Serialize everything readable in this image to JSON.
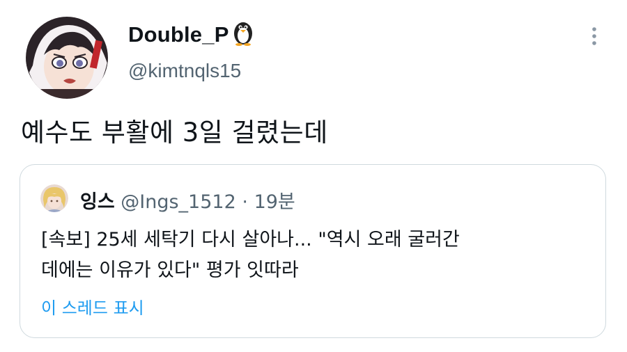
{
  "tweet": {
    "author": {
      "display_name": "Double_P",
      "handle": "@kimtnqls15",
      "avatar_icon": "anime-girl-avatar",
      "name_emoji_icon": "penguin-icon"
    },
    "more_icon": "more-vertical-icon",
    "text": "예수도 부활에 3일 걸렸는데"
  },
  "quote": {
    "author": {
      "display_name": "잉스",
      "handle": "@Ings_1512",
      "separator": "·",
      "time": "19분",
      "avatar_icon": "blonde-character-avatar"
    },
    "text_lines": [
      "[속보] 25세 세탁기 다시 살아나... \"역시 오래 굴러간",
      "데에는 이유가 있다\" 평가 잇따라"
    ],
    "show_thread": "이 스레드 표시"
  },
  "colors": {
    "text_primary": "#0f1419",
    "text_secondary": "#536471",
    "link": "#1d9bf0",
    "border": "#cfd9de"
  }
}
